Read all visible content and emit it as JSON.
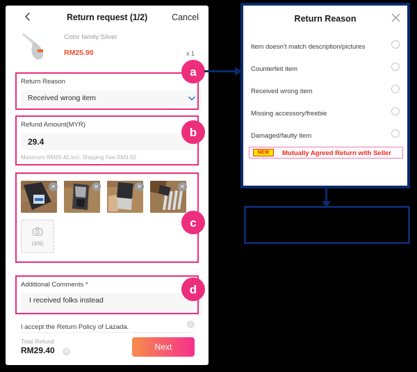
{
  "phone": {
    "header": {
      "back_icon": "chevron-left-icon",
      "title": "Return request (1/2)",
      "cancel_label": "Cancel"
    },
    "product": {
      "image_alt": "silver-ladle-product-image",
      "color_family": "Color family:Silver",
      "price": "RM25.90",
      "quantity": "x 1"
    },
    "return_reason": {
      "label": "Return Reason",
      "selected_value": "Received wrong item",
      "chevron_icon": "chevron-down-icon"
    },
    "refund_amount": {
      "label": "Refund Amount(MYR)",
      "value": "29.4",
      "hint": "Maximum RM29.40,Incl. Shipping Fee RM3.50"
    },
    "photos": {
      "thumbnails": [
        {
          "alt": "forks-in-packaging-photo-1",
          "remove_icon": "close-icon"
        },
        {
          "alt": "forks-in-packaging-photo-2",
          "remove_icon": "close-icon"
        },
        {
          "alt": "forks-in-packaging-photo-3",
          "remove_icon": "close-icon"
        },
        {
          "alt": "forks-in-hand-photo-4",
          "remove_icon": "close-icon"
        }
      ],
      "add_icon": "camera-icon",
      "counter": "(4/6)"
    },
    "additional_comments": {
      "label": "Additional Comments *",
      "value": "I received folks instead"
    },
    "policy": {
      "text": "I accept the Return Policy of Lazada.",
      "info_icon": "info-icon",
      "info_glyph": "i"
    },
    "footer": {
      "total_label": "Total Refund",
      "total_value": "RM29.40",
      "help_icon": "question-icon",
      "help_glyph": "?",
      "next_label": "Next"
    }
  },
  "callouts": [
    {
      "id": "a",
      "label": "a"
    },
    {
      "id": "b",
      "label": "b"
    },
    {
      "id": "c",
      "label": "c"
    },
    {
      "id": "d",
      "label": "d"
    }
  ],
  "dialog": {
    "title": "Return Reason",
    "close_icon": "close-icon",
    "options": [
      {
        "label": "Item doesn't match description/pictures",
        "selected": false
      },
      {
        "label": "Counterfeit item",
        "selected": false
      },
      {
        "label": "Received wrong item",
        "selected": false
      },
      {
        "label": "Missing accessory/freebie",
        "selected": false
      },
      {
        "label": "Damaged/faulty item",
        "selected": false
      }
    ],
    "highlighted_option": {
      "badge": "NEW",
      "label": "Mutually Agreed Return with Seller"
    }
  },
  "empty_box": {
    "content": ""
  },
  "colors": {
    "accent_pink": "#ec2d7a",
    "connector_blue": "#0b2a6b",
    "price_red": "#f5482d",
    "highlight_red": "#ee2a22",
    "badge_yellow": "#ffe400",
    "button_gradient_start": "#f78d4b",
    "button_gradient_end": "#f5308c"
  }
}
